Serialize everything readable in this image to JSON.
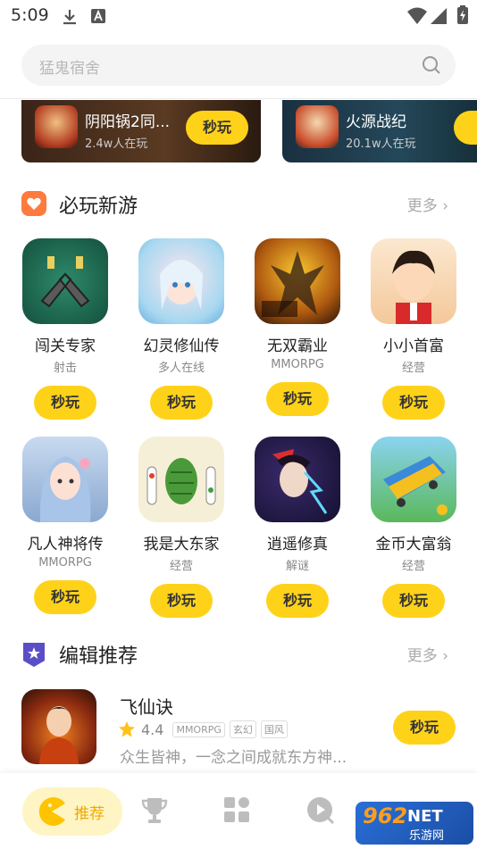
{
  "status": {
    "time": "5:09"
  },
  "search": {
    "placeholder": "猛鬼宿舍"
  },
  "banners": [
    {
      "name": "阴阳锅2同...",
      "players": "2.4w人在玩",
      "play": "秒玩"
    },
    {
      "name": "火源战纪",
      "players": "20.1w人在玩",
      "play": "秒"
    }
  ],
  "section_new": {
    "title": "必玩新游",
    "more": "更多"
  },
  "games": [
    {
      "name": "闯关专家",
      "category": "射击",
      "play": "秒玩"
    },
    {
      "name": "幻灵修仙传",
      "category": "多人在线",
      "play": "秒玩"
    },
    {
      "name": "无双霸业",
      "category": "MMORPG",
      "play": "秒玩"
    },
    {
      "name": "小小首富",
      "category": "经营",
      "play": "秒玩"
    },
    {
      "name": "凡人神将传",
      "category": "MMORPG",
      "play": "秒玩"
    },
    {
      "name": "我是大东家",
      "category": "经营",
      "play": "秒玩"
    },
    {
      "name": "逍遥修真",
      "category": "解谜",
      "play": "秒玩"
    },
    {
      "name": "金币大富翁",
      "category": "经营",
      "play": "秒玩"
    }
  ],
  "section_pick": {
    "title": "编辑推荐",
    "more": "更多"
  },
  "pick": {
    "name": "飞仙诀",
    "score": "4.4",
    "tags": [
      "MMORPG",
      "玄幻",
      "国风"
    ],
    "description": "众生皆神，一念之间成就东方神...",
    "play": "秒玩"
  },
  "nav": {
    "active_label": "推荐",
    "items": [
      "home-icon",
      "trophy-icon",
      "grid-icon",
      "video-icon"
    ]
  },
  "watermark": {
    "brand": "962",
    "brand_suffix": "NET",
    "sub": "乐游网"
  },
  "colors": {
    "accent": "#ffd21a",
    "active_bg": "#fff4c4",
    "active_text": "#f0a800"
  }
}
